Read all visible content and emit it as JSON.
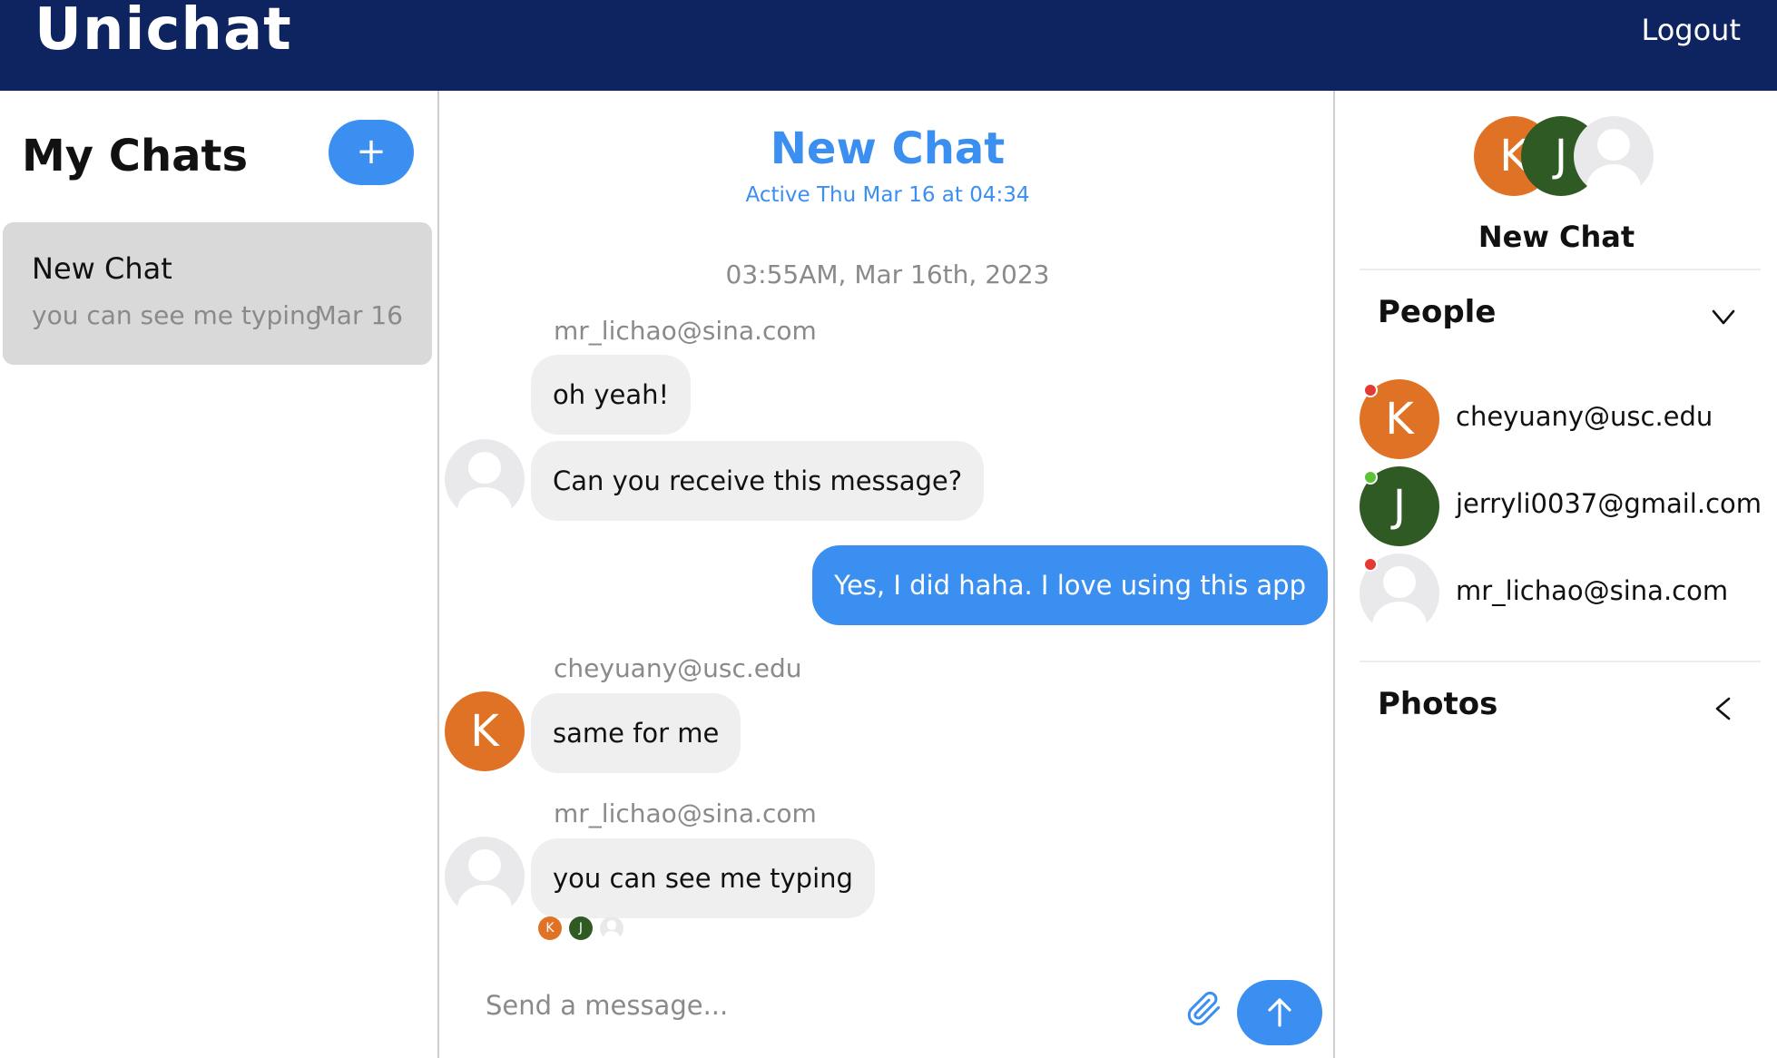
{
  "header": {
    "brand": "Unichat",
    "logout_label": "Logout"
  },
  "sidebar": {
    "title": "My Chats",
    "new_chat_icon": "plus-icon",
    "chats": [
      {
        "title": "New Chat",
        "preview": "you can see me typing",
        "date": "Mar 16"
      }
    ]
  },
  "chat": {
    "title": "New Chat",
    "active_status": "Active Thu Mar 16 at 04:34",
    "timestamp": "03:55AM, Mar 16th, 2023",
    "messages": [
      {
        "sender": "mr_lichao@sina.com",
        "text": "oh yeah!"
      },
      {
        "text": "Can you receive this message?"
      },
      {
        "text": "Yes, I did haha. I love using this app",
        "mine": true
      },
      {
        "sender": "cheyuany@usc.edu",
        "text": "same for me",
        "avatar_letter": "K"
      },
      {
        "sender": "mr_lichao@sina.com",
        "text": "you can see me typing"
      }
    ],
    "read_receipts": [
      "K",
      "J",
      ""
    ],
    "composer": {
      "placeholder": "Send a message...",
      "attach_icon": "paperclip-icon",
      "send_icon": "arrow-up-icon"
    }
  },
  "details": {
    "avatars": [
      "K",
      "J",
      ""
    ],
    "title": "New Chat",
    "people_section": {
      "label": "People",
      "icon": "chevron-down-icon"
    },
    "people": [
      {
        "letter": "K",
        "email": "cheyuany@usc.edu",
        "status": "offline",
        "status_color": "#e53935"
      },
      {
        "letter": "J",
        "email": "jerryli0037@gmail.com",
        "status": "online",
        "status_color": "#5dc236"
      },
      {
        "letter": "",
        "email": "mr_lichao@sina.com",
        "status": "offline",
        "status_color": "#e53935"
      }
    ],
    "photos_section": {
      "label": "Photos",
      "icon": "chevron-left-icon"
    }
  },
  "colors": {
    "header_bg": "#0d2461",
    "accent": "#3b8ff0",
    "bubble_bg": "#efefef",
    "avatar_k": "#e07226",
    "avatar_j": "#2f5a24"
  }
}
